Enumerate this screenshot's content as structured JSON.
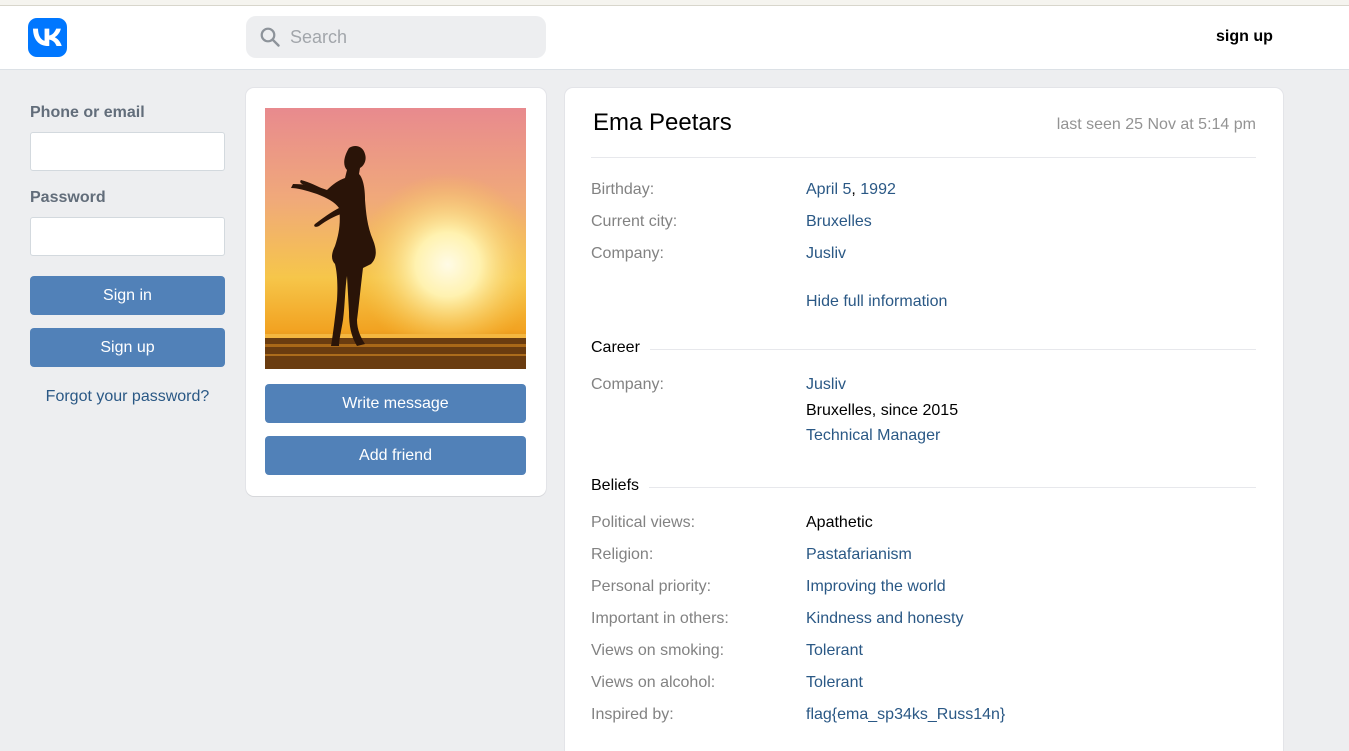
{
  "header": {
    "logo_icon": "vk-logo-icon",
    "search_placeholder": "Search",
    "signup_label": "sign up"
  },
  "login": {
    "phone_label": "Phone or email",
    "password_label": "Password",
    "signin_label": "Sign in",
    "signup_label": "Sign up",
    "forgot_label": "Forgot your password?"
  },
  "photo_card": {
    "write_label": "Write message",
    "add_label": "Add friend"
  },
  "profile": {
    "name": "Ema Peetars",
    "last_seen": "last seen 25 Nov at 5:14 pm",
    "birthday_label": "Birthday:",
    "birthday_day": "April 5",
    "birthday_sep": ",",
    "birthday_year": "1992",
    "city_label": "Current city:",
    "city": "Bruxelles",
    "company_label": "Company:",
    "company": "Jusliv",
    "hide_info": "Hide full information",
    "career": {
      "title": "Career",
      "company_label": "Company:",
      "company": "Jusliv",
      "location": "Bruxelles, since 2015",
      "position": "Technical Manager"
    },
    "beliefs": {
      "title": "Beliefs",
      "items": [
        {
          "label": "Political views:",
          "value": "Apathetic"
        },
        {
          "label": "Religion:",
          "value": "Pastafarianism"
        },
        {
          "label": "Personal priority:",
          "value": "Improving the world"
        },
        {
          "label": "Important in others:",
          "value": "Kindness and honesty"
        },
        {
          "label": "Views on smoking:",
          "value": "Tolerant"
        },
        {
          "label": "Views on alcohol:",
          "value": "Tolerant"
        },
        {
          "label": "Inspired by:",
          "value": "flag{ema_sp34ks_Russ14n}"
        }
      ]
    }
  },
  "colors": {
    "accent": "#5181b8",
    "link": "#2a5885",
    "brand": "#0077ff",
    "background": "#edeef0"
  }
}
